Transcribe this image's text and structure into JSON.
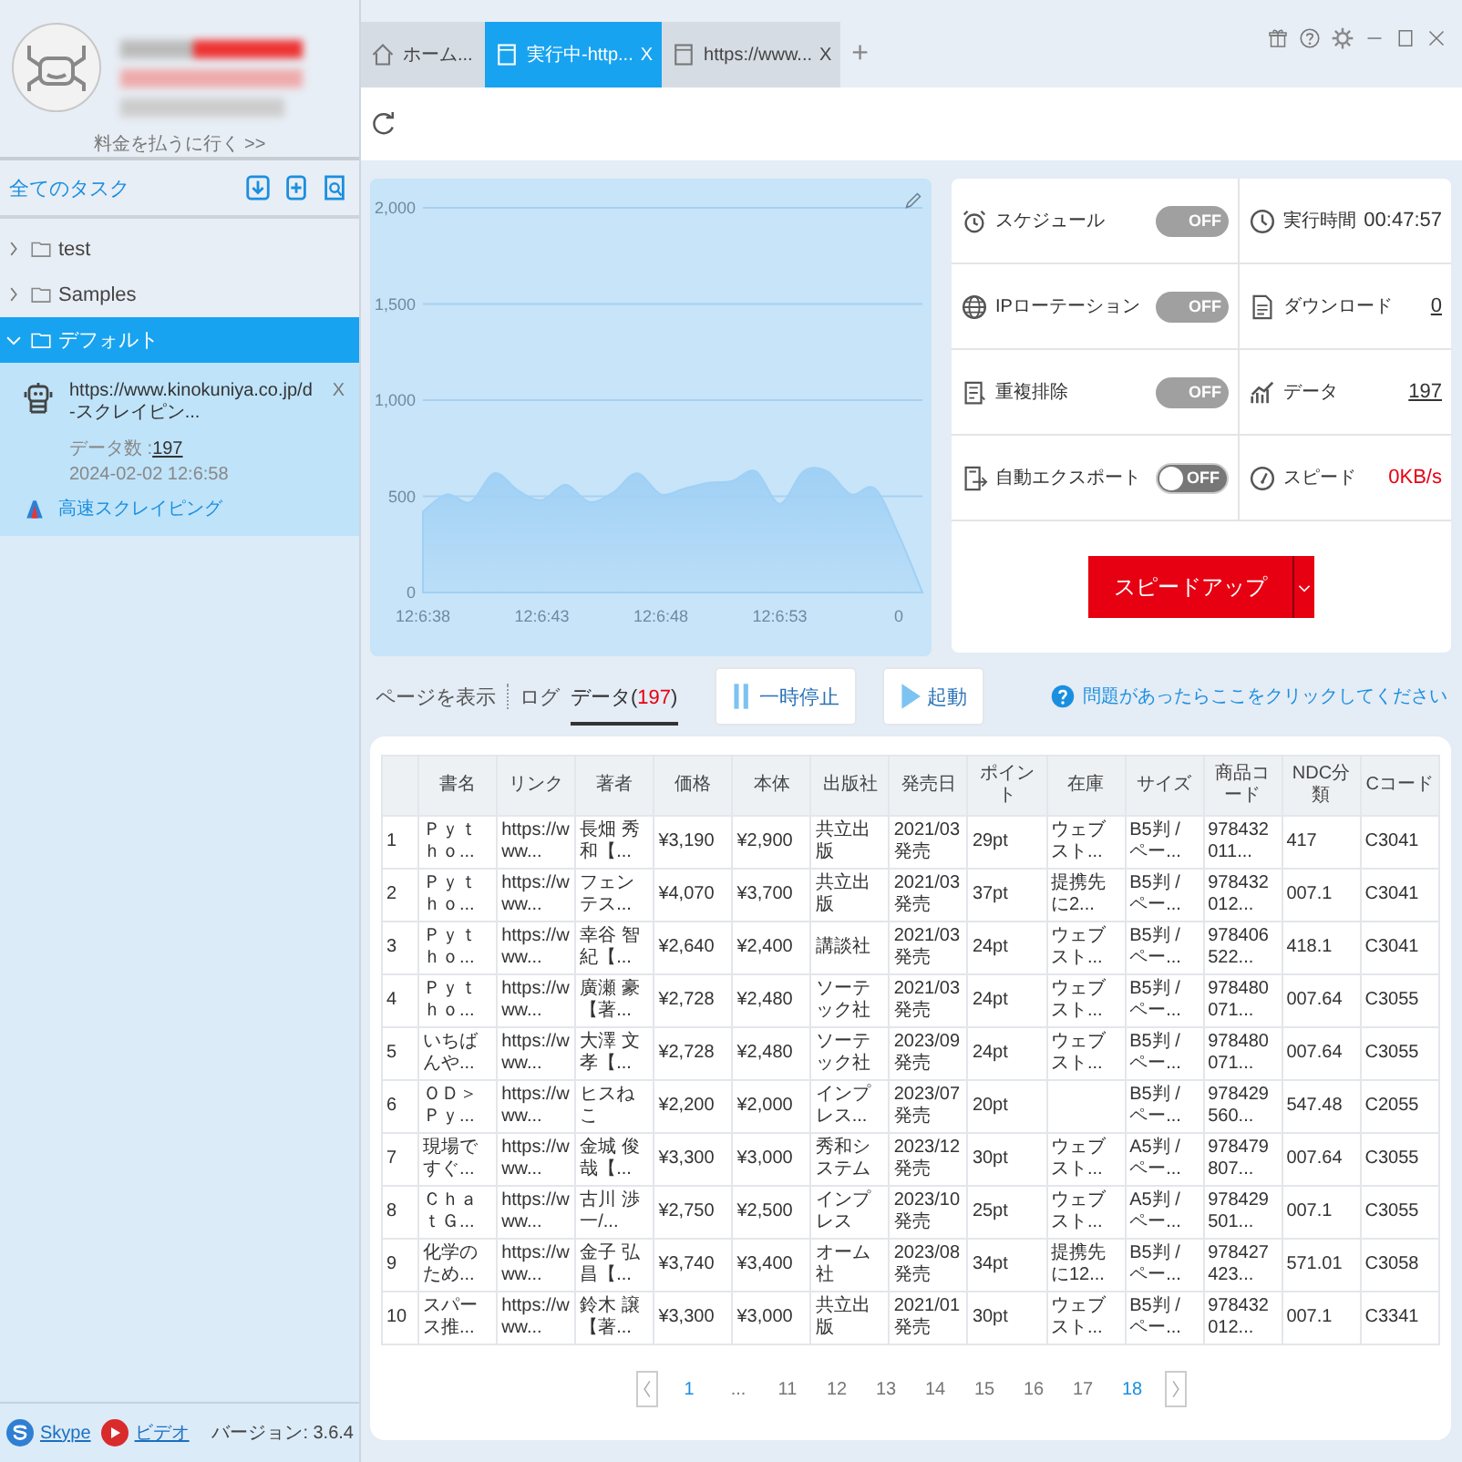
{
  "sidebar": {
    "pay_link": "料金を払うに行く >>",
    "tasks_title": "全てのタスク",
    "tree": [
      {
        "label": "test",
        "expanded": false,
        "selected": false
      },
      {
        "label": "Samples",
        "expanded": false,
        "selected": false
      },
      {
        "label": "デフォルト",
        "expanded": true,
        "selected": true,
        "tasks": [
          {
            "url": "https://www.kinokuniya.co.jp/d-スクレイピン...",
            "close": "X",
            "data_label": "データ数 :",
            "data_count": "197",
            "date": "2024-02-02 12:6:58",
            "mode": "高速スクレイピング"
          }
        ]
      }
    ],
    "footer": {
      "links": [
        "Skype",
        "ビデオ"
      ],
      "version": "バージョン: 3.6.4"
    }
  },
  "tabs": [
    {
      "label": "ホーム...",
      "kind": "home",
      "selected": false
    },
    {
      "label": "実行中-http...",
      "kind": "page",
      "selected": true,
      "close": "X"
    },
    {
      "label": "https://www...",
      "kind": "page",
      "selected": false,
      "close": "X"
    }
  ],
  "new_tab": "+",
  "chart": {
    "chart_data": {
      "type": "area",
      "grid": true,
      "categories": [
        "12:6:38",
        null,
        null,
        null,
        null,
        "12:6:43",
        null,
        null,
        null,
        null,
        "12:6:48",
        null,
        null,
        null,
        null,
        "12:6:53",
        null,
        null,
        null,
        null,
        "0",
        null
      ],
      "ylim": [
        0,
        2000
      ],
      "series": [
        {
          "color": "#9fd0f5",
          "values": [
            420,
            510,
            470,
            620,
            530,
            480,
            560,
            470,
            520,
            620,
            510,
            540,
            570,
            580,
            630,
            460,
            630,
            630,
            510,
            540,
            300,
            0
          ]
        }
      ],
      "yticks": [
        {
          "value": 0,
          "label": "0"
        },
        {
          "value": 500,
          "label": "500"
        },
        {
          "value": 1000,
          "label": "1,000"
        },
        {
          "value": 1500,
          "label": "1,500"
        },
        {
          "value": 2000,
          "label": "2,000"
        }
      ]
    }
  },
  "stats": {
    "settings": [
      {
        "label": "スケジュール",
        "state": "OFF",
        "on": false,
        "disabled": true
      },
      {
        "label": "IPローテーション",
        "state": "OFF",
        "on": false,
        "disabled": true
      },
      {
        "label": "重複排除",
        "state": "OFF",
        "on": false,
        "disabled": true
      },
      {
        "label": "自動エクスポート",
        "state": "OFF",
        "on": false,
        "disabled": false
      }
    ],
    "metrics": [
      {
        "label": "実行時間",
        "value": "00:47:57",
        "kind": "plain"
      },
      {
        "label": "ダウンロード",
        "value": "0",
        "kind": "link"
      },
      {
        "label": "データ",
        "value": "197",
        "kind": "link"
      },
      {
        "label": "スピード",
        "value": "0KB/s",
        "kind": "alert"
      }
    ],
    "speed_up": "スピードアップ"
  },
  "view_tabs": [
    {
      "label": "ページを表示",
      "selected": false
    },
    {
      "label": "ログ",
      "selected": false
    },
    {
      "label": "データ(",
      "count": "197",
      "suffix": ")",
      "selected": true
    }
  ],
  "actions": [
    {
      "label": "一時停止",
      "kind": "pause"
    },
    {
      "label": "起動",
      "kind": "start"
    }
  ],
  "help_link": "問題があったらここをクリックしてください",
  "table": {
    "columns": [
      "書名",
      "リンク",
      "著者",
      "価格",
      "本体",
      "出版社",
      "発売日",
      "ポイント",
      "在庫",
      "サイズ",
      "商品コード",
      "NDC分類",
      "Cコード"
    ],
    "rows": [
      {
        "index": "1",
        "cells": [
          "Ｐｙｔｈｏ...",
          "https://www...",
          "長畑 秀和【...",
          "¥3,190",
          "¥2,900",
          "共立出版",
          "2021/03発売",
          "29pt",
          "ウェブスト...",
          "B5判 / ペー...",
          "978432011...",
          "417",
          "C3041"
        ]
      },
      {
        "index": "2",
        "cells": [
          "Ｐｙｔｈｏ...",
          "https://www...",
          "フェンテス...",
          "¥4,070",
          "¥3,700",
          "共立出版",
          "2021/03発売",
          "37pt",
          "提携先に2...",
          "B5判 / ペー...",
          "978432012...",
          "007.1",
          "C3041"
        ]
      },
      {
        "index": "3",
        "cells": [
          "Ｐｙｔｈｏ...",
          "https://www...",
          "幸谷 智紀【...",
          "¥2,640",
          "¥2,400",
          "講談社",
          "2021/03発売",
          "24pt",
          "ウェブスト...",
          "B5判 / ペー...",
          "978406522...",
          "418.1",
          "C3041"
        ]
      },
      {
        "index": "4",
        "cells": [
          "Ｐｙｔｈｏ...",
          "https://www...",
          "廣瀬 豪【著...",
          "¥2,728",
          "¥2,480",
          "ソーテック社",
          "2021/03発売",
          "24pt",
          "ウェブスト...",
          "B5判 / ペー...",
          "978480071...",
          "007.64",
          "C3055"
        ]
      },
      {
        "index": "5",
        "cells": [
          "いちばんや...",
          "https://www...",
          "大澤 文孝【...",
          "¥2,728",
          "¥2,480",
          "ソーテック社",
          "2023/09発売",
          "24pt",
          "ウェブスト...",
          "B5判 / ペー...",
          "978480071...",
          "007.64",
          "C3055"
        ]
      },
      {
        "index": "6",
        "cells": [
          "ＯＤ＞Ｐｙ...",
          "https://www...",
          "ヒスねこ",
          "¥2,200",
          "¥2,000",
          "インプレス...",
          "2023/07発売",
          "20pt",
          null,
          "B5判 / ペー...",
          "978429560...",
          "547.48",
          "C2055"
        ]
      },
      {
        "index": "7",
        "cells": [
          "現場ですぐ...",
          "https://www...",
          "金城 俊哉【...",
          "¥3,300",
          "¥3,000",
          "秀和システム",
          "2023/12発売",
          "30pt",
          "ウェブスト...",
          "A5判 / ペー...",
          "978479807...",
          "007.64",
          "C3055"
        ]
      },
      {
        "index": "8",
        "cells": [
          "ＣｈａｔＧ...",
          "https://www...",
          "古川 渉一/...",
          "¥2,750",
          "¥2,500",
          "インプレス",
          "2023/10発売",
          "25pt",
          "ウェブスト...",
          "A5判 / ペー...",
          "978429501...",
          "007.1",
          "C3055"
        ]
      },
      {
        "index": "9",
        "cells": [
          "化学のため...",
          "https://www...",
          "金子 弘昌【...",
          "¥3,740",
          "¥3,400",
          "オーム社",
          "2023/08発売",
          "34pt",
          "提携先に12...",
          "B5判 / ペー...",
          "978427423...",
          "571.01",
          "C3058"
        ]
      },
      {
        "index": "10",
        "cells": [
          "スパース推...",
          "https://www...",
          "鈴木 譲【著...",
          "¥3,300",
          "¥3,000",
          "共立出版",
          "2021/01発売",
          "30pt",
          "ウェブスト...",
          "B5判 / ペー...",
          "978432012...",
          "007.1",
          "C3341"
        ]
      }
    ]
  },
  "pager": [
    {
      "label": "1",
      "kind": "link"
    },
    {
      "label": "...",
      "kind": "ellipsis"
    },
    {
      "label": "11",
      "kind": "page"
    },
    {
      "label": "12",
      "kind": "page"
    },
    {
      "label": "13",
      "kind": "page"
    },
    {
      "label": "14",
      "kind": "page"
    },
    {
      "label": "15",
      "kind": "page"
    },
    {
      "label": "16",
      "kind": "page"
    },
    {
      "label": "17",
      "kind": "page"
    },
    {
      "label": "18",
      "kind": "link"
    }
  ]
}
